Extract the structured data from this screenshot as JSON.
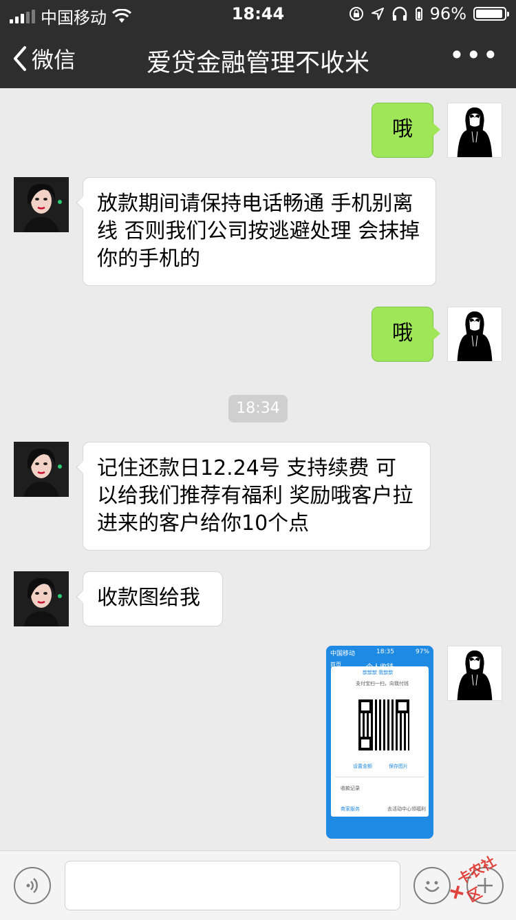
{
  "status_bar": {
    "carrier": "中国移动",
    "time": "18:44",
    "battery_percent": "96%",
    "battery_level": 0.96,
    "icons": [
      "signal-icon",
      "wifi-icon",
      "rotation-lock-icon",
      "location-icon",
      "headphones-icon",
      "battery-icon"
    ]
  },
  "nav": {
    "back_label": "微信",
    "title": "爱贷金融管理不收米",
    "more_label": "•••"
  },
  "messages": [
    {
      "side": "out",
      "text": "哦"
    },
    {
      "side": "in",
      "text": "放款期间请保持电话畅通 手机别离线 否则我们公司按逃避处理 会抹掉你的手机的"
    },
    {
      "side": "out",
      "text": "哦"
    },
    {
      "side": "in",
      "text": "记住还款日12.24号 支持续费 可以给我们推荐有福利 奖励哦客户拉进来的客户给你10个点"
    },
    {
      "side": "in",
      "text": "收款图给我"
    }
  ],
  "timestamp": "18:34",
  "image_message": {
    "carrier": "中国移动",
    "time": "18:35",
    "battery": "97%",
    "back": "首页",
    "title": "个人收钱",
    "payee": "歆歆歆 我歆歆",
    "hint": "支付宝扫一扫，向我付钱",
    "set_amount": "设置金额",
    "save_image": "保存图片",
    "records": "收款记录",
    "merchant_service": "商家服务",
    "merchant_link": "去活动中心领福利"
  },
  "watermark": "卡农社区",
  "colors": {
    "header_bg": "#2e2e2e",
    "chat_bg": "#ebebeb",
    "out_bubble": "#9fe658",
    "in_bubble": "#ffffff",
    "alipay_blue": "#1e8ae3"
  }
}
